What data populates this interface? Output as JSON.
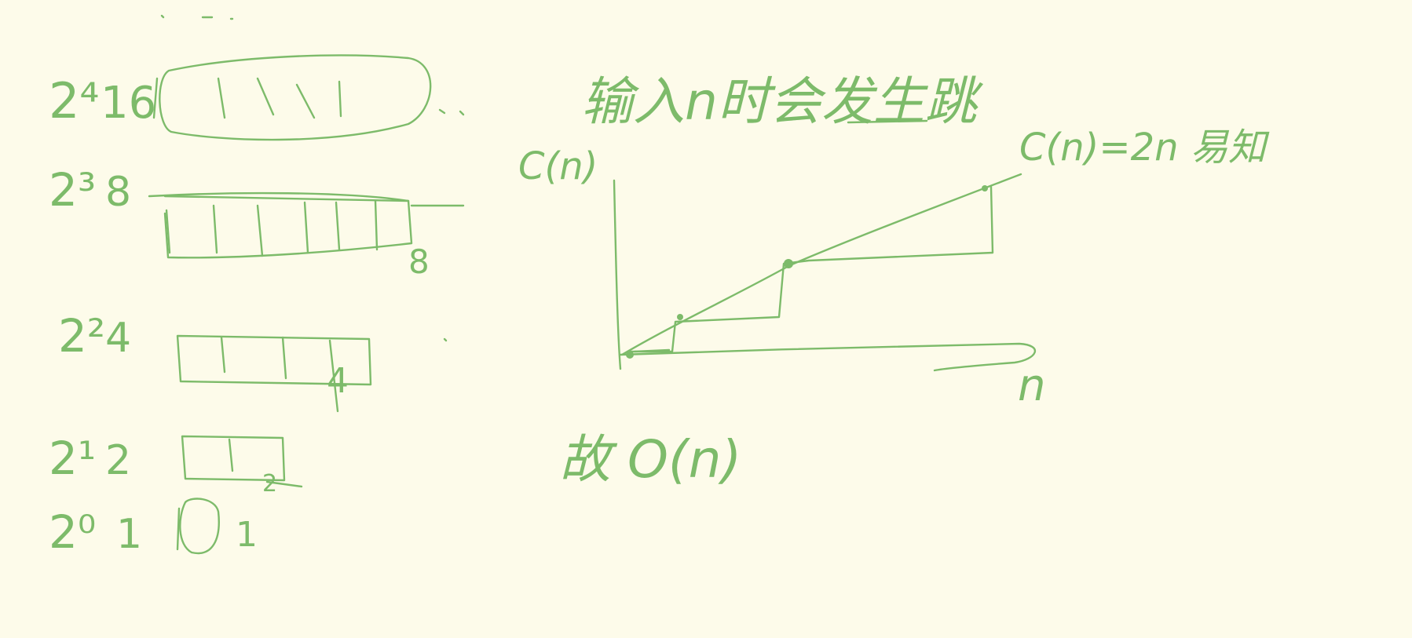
{
  "note": {
    "rows": [
      {
        "power": "2⁴",
        "value": "16"
      },
      {
        "power": "2³",
        "value": "8"
      },
      {
        "power": "2²",
        "value": "4"
      },
      {
        "power": "2¹",
        "value": "2"
      },
      {
        "power": "2⁰",
        "value": "1"
      }
    ],
    "box_tick_labels": [
      "8",
      "4",
      "2",
      "1"
    ],
    "heading": "输入n时会发生跳",
    "graph": {
      "y_label": "C(n)",
      "x_label": "n",
      "line_label": "C(n)=2n 易知"
    },
    "conclusion": "故 O(n)"
  },
  "colors": {
    "ink": "#7dbb6a",
    "paper": "#fdfbea"
  }
}
